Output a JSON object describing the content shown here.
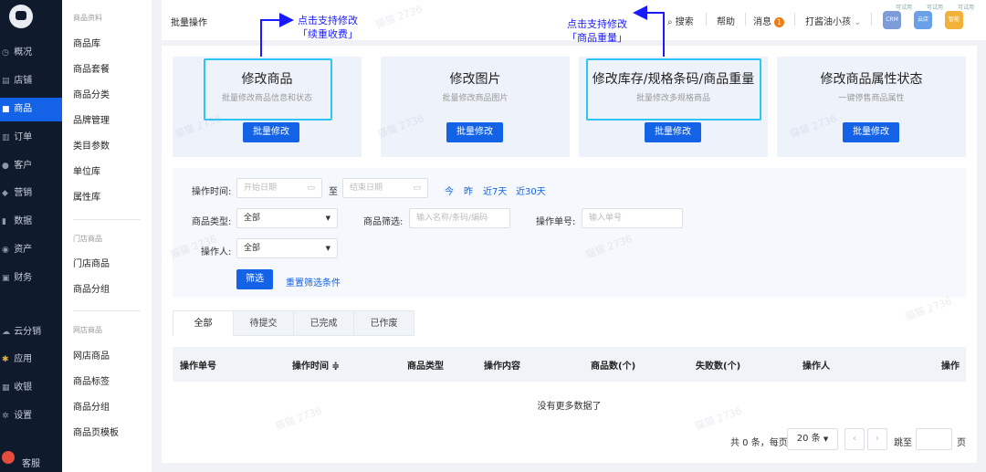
{
  "nav": {
    "items": [
      {
        "label": "概况",
        "icon": "gauge-icon"
      },
      {
        "label": "店铺",
        "icon": "store-icon"
      },
      {
        "label": "商品",
        "icon": "goods-icon",
        "active": true
      },
      {
        "label": "订单",
        "icon": "order-icon"
      },
      {
        "label": "客户",
        "icon": "user-icon"
      },
      {
        "label": "营销",
        "icon": "marketing-icon"
      },
      {
        "label": "数据",
        "icon": "data-icon"
      },
      {
        "label": "资产",
        "icon": "asset-icon"
      },
      {
        "label": "财务",
        "icon": "finance-icon"
      },
      {
        "label": "云分销",
        "icon": "cloud-icon"
      },
      {
        "label": "应用",
        "icon": "app-icon"
      },
      {
        "label": "收银",
        "icon": "cashier-icon"
      },
      {
        "label": "设置",
        "icon": "gear-icon"
      },
      {
        "label": "客服",
        "icon": "service-icon"
      }
    ]
  },
  "submenu": {
    "group1": "商品资料",
    "group1_items": [
      "商品库",
      "商品套餐",
      "商品分类",
      "品牌管理",
      "类目参数",
      "单位库",
      "属性库"
    ],
    "group2": "门店商品",
    "group2_items": [
      "门店商品",
      "商品分组"
    ],
    "group3": "网店商品",
    "group3_items": [
      "网店商品",
      "商品标签",
      "商品分组",
      "商品页模板"
    ]
  },
  "header": {
    "title": "批量操作",
    "search": "搜索",
    "help": "帮助",
    "messages": "消息",
    "message_count": "1",
    "user": "打酱油小孩",
    "apps": [
      {
        "tag": "可试用",
        "label": "CRM",
        "color": "#7d9bd6"
      },
      {
        "tag": "可试用",
        "label": "云店",
        "color": "#6aa0e8"
      },
      {
        "tag": "可试用",
        "label": "智能",
        "color": "#f2b23a"
      }
    ]
  },
  "cards": [
    {
      "title": "修改商品",
      "desc": "批量修改商品信息和状态",
      "button": "批量修改"
    },
    {
      "title": "修改图片",
      "desc": "批量修改商品图片",
      "button": "批量修改"
    },
    {
      "title": "修改库存/规格条码/商品重量",
      "desc": "批量修改多规格商品",
      "button": "批量修改"
    },
    {
      "title": "修改商品属性状态",
      "desc": "一键停售商品属性",
      "button": "批量修改"
    }
  ],
  "annotations": {
    "left": [
      "点击支持修改",
      "「续重收费」"
    ],
    "right": [
      "点击支持修改",
      "「商品重量」"
    ],
    "color": "#1a1aff"
  },
  "filter": {
    "time_label": "操作时间:",
    "start_placeholder": "开始日期",
    "to": "至",
    "end_placeholder": "结束日期",
    "quick": [
      "今",
      "昨",
      "近7天",
      "近30天"
    ],
    "type_label": "商品类型:",
    "type_value": "全部",
    "goods_filter_label": "商品筛选:",
    "goods_filter_placeholder": "输入名称/条码/编码",
    "order_label": "操作单号:",
    "order_placeholder": "输入单号",
    "operator_label": "操作人:",
    "operator_value": "全部",
    "filter_button": "筛选",
    "reset": "重置筛选条件"
  },
  "tabs": [
    "全部",
    "待提交",
    "已完成",
    "已作废"
  ],
  "table": {
    "columns": [
      "操作单号",
      "操作时间 ≑",
      "商品类型",
      "操作内容",
      "商品数(个)",
      "失败数(个)",
      "操作人",
      "操作"
    ],
    "empty": "没有更多数据了"
  },
  "pager": {
    "summary": "共 0 条，每页",
    "page_size": "20 条",
    "goto": "跳至",
    "unit": "页"
  },
  "colors": {
    "primary": "#1463e6",
    "highlight": "#2fc5f2",
    "nav_bg": "#0f1b2d"
  },
  "watermark": "猫猫 2736"
}
